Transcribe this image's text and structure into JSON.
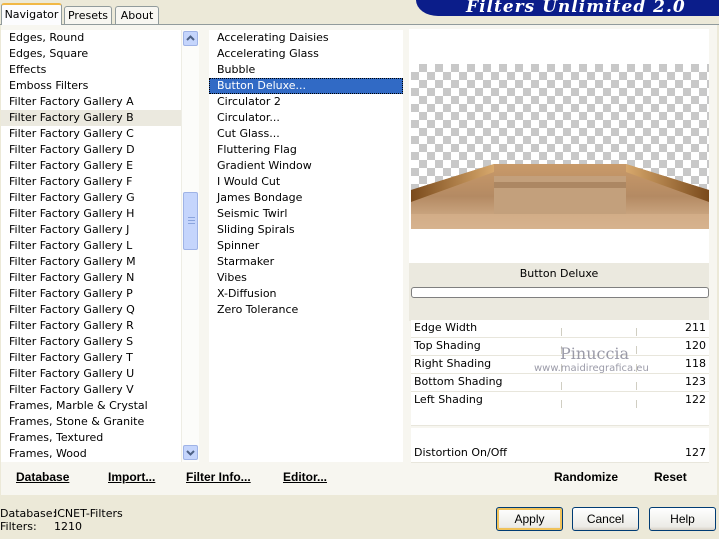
{
  "tabs": [
    "Navigator",
    "Presets",
    "About"
  ],
  "title": "Filters Unlimited 2.0",
  "categories": [
    "Edges, Round",
    "Edges, Square",
    "Effects",
    "Emboss Filters",
    "Filter Factory Gallery A",
    "Filter Factory Gallery B",
    "Filter Factory Gallery C",
    "Filter Factory Gallery D",
    "Filter Factory Gallery E",
    "Filter Factory Gallery F",
    "Filter Factory Gallery G",
    "Filter Factory Gallery H",
    "Filter Factory Gallery J",
    "Filter Factory Gallery L",
    "Filter Factory Gallery M",
    "Filter Factory Gallery N",
    "Filter Factory Gallery P",
    "Filter Factory Gallery Q",
    "Filter Factory Gallery R",
    "Filter Factory Gallery S",
    "Filter Factory Gallery T",
    "Filter Factory Gallery U",
    "Filter Factory Gallery V",
    "Frames, Marble & Crystal",
    "Frames, Stone & Granite",
    "Frames, Textured",
    "Frames, Wood"
  ],
  "selected_category": "Filter Factory Gallery B",
  "filters": [
    "Accelerating Daisies",
    "Accelerating Glass",
    "Bubble",
    "Button Deluxe...",
    "Circulator 2",
    "Circulator...",
    "Cut Glass...",
    "Fluttering Flag",
    "Gradient Window",
    "I Would Cut",
    "James Bondage",
    "Seismic Twirl",
    "Sliding Spirals",
    "Spinner",
    "Starmaker",
    "Vibes",
    "X-Diffusion",
    "Zero Tolerance"
  ],
  "selected_filter": "Button Deluxe...",
  "filter_name": "Button Deluxe",
  "params": [
    {
      "label": "Edge Width",
      "value": "211"
    },
    {
      "label": "Top Shading",
      "value": "120"
    },
    {
      "label": "Right Shading",
      "value": "118"
    },
    {
      "label": "Bottom Shading",
      "value": "123"
    },
    {
      "label": "Left Shading",
      "value": "122"
    }
  ],
  "distortion": {
    "label": "Distortion On/Off",
    "value": "127"
  },
  "watermark": {
    "line1": "Pinuccia",
    "line2": "www.maidiregrafica.eu"
  },
  "actions": {
    "database": "Database",
    "import": "Import...",
    "filter_info": "Filter Info...",
    "editor": "Editor...",
    "randomize": "Randomize",
    "reset": "Reset"
  },
  "status": {
    "db_label": "Database:",
    "db_value": "ICNET-Filters",
    "filters_label": "Filters:",
    "filters_value": "1210"
  },
  "buttons": {
    "apply": "Apply",
    "cancel": "Cancel",
    "help": "Help"
  }
}
